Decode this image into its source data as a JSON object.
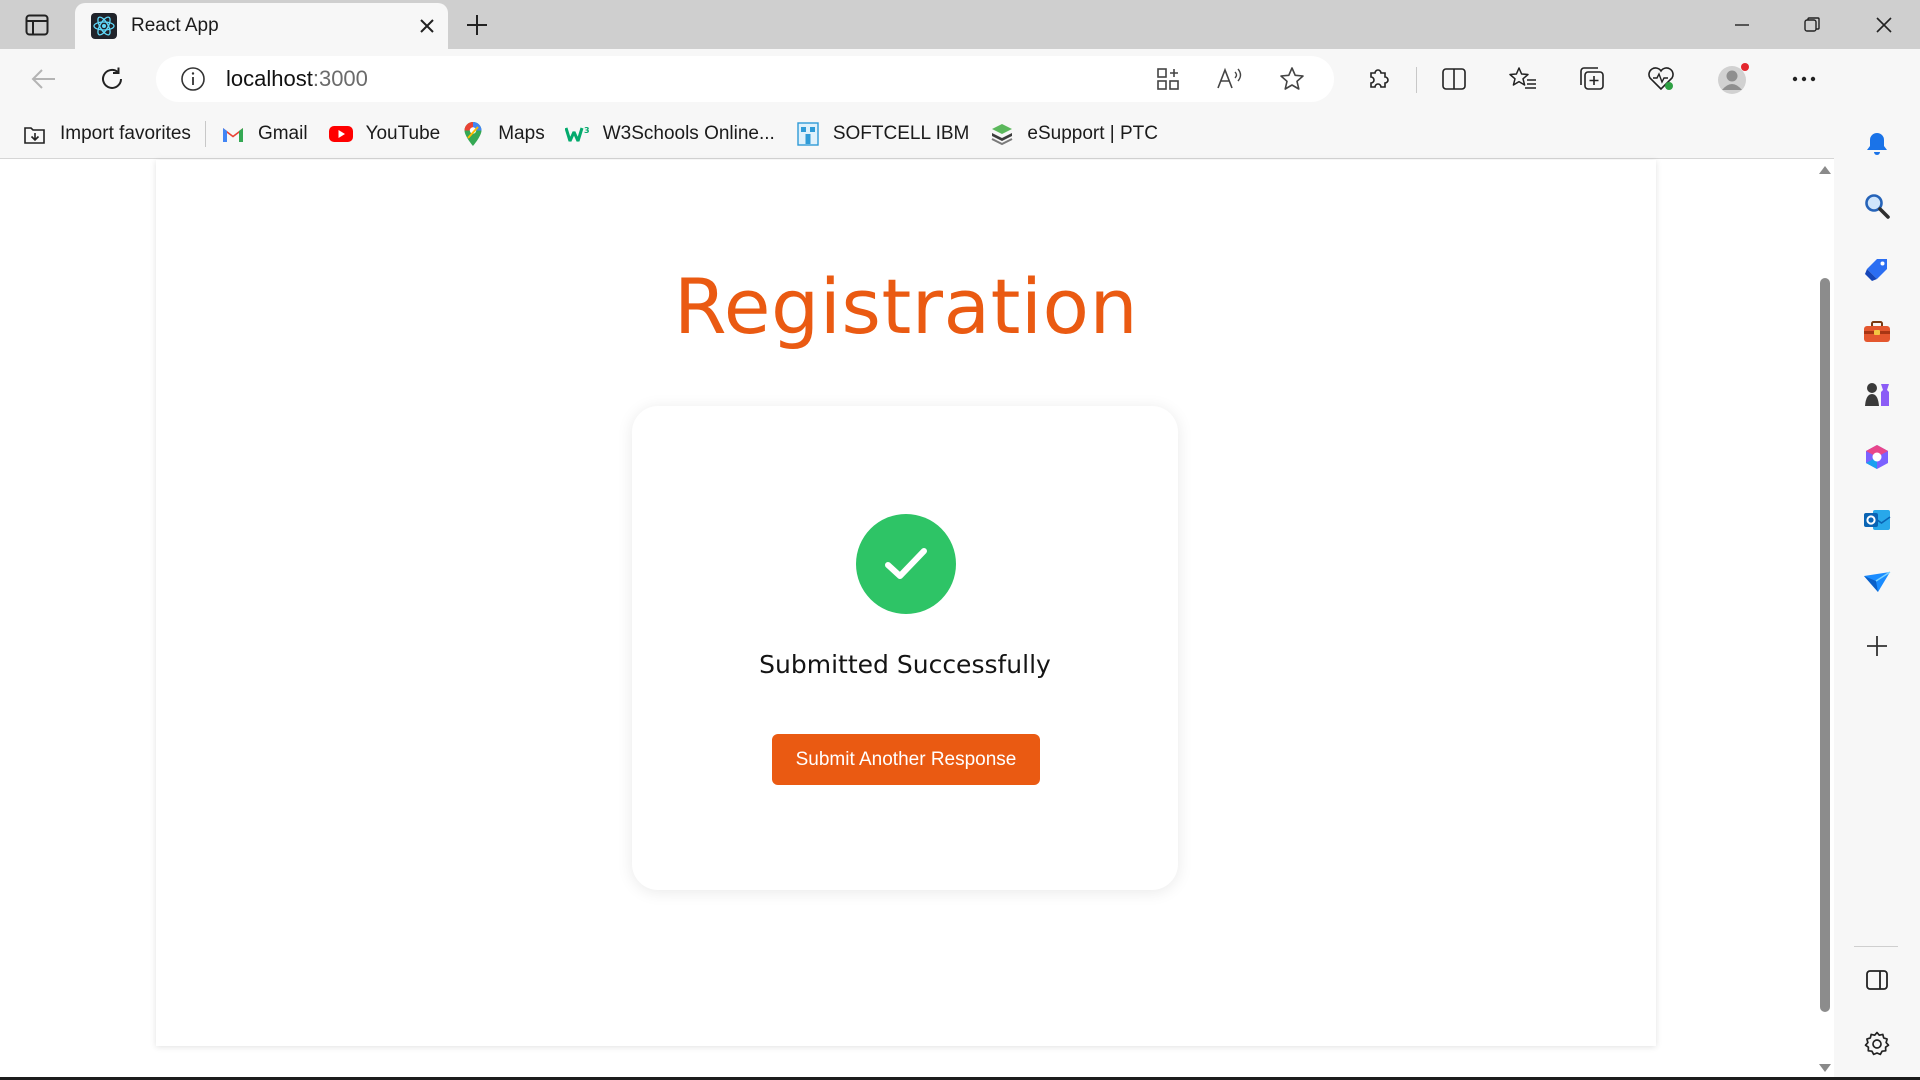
{
  "browser": {
    "tab": {
      "title": "React App"
    },
    "address": {
      "host": "localhost",
      "port": ":3000"
    },
    "bookmarks": [
      {
        "label": "Import favorites",
        "icon": "import-favorites-icon"
      },
      {
        "label": "Gmail",
        "icon": "gmail-icon"
      },
      {
        "label": "YouTube",
        "icon": "youtube-icon"
      },
      {
        "label": "Maps",
        "icon": "maps-icon"
      },
      {
        "label": "W3Schools Online...",
        "icon": "w3schools-icon"
      },
      {
        "label": "SOFTCELL IBM",
        "icon": "softcell-icon"
      },
      {
        "label": "eSupport | PTC",
        "icon": "esupport-icon"
      }
    ]
  },
  "page": {
    "title": "Registration",
    "status_text": "Submitted Successfully",
    "submit_again_label": "Submit Another Response"
  },
  "colors": {
    "accent": "#ea5a12",
    "success": "#2ec466"
  }
}
